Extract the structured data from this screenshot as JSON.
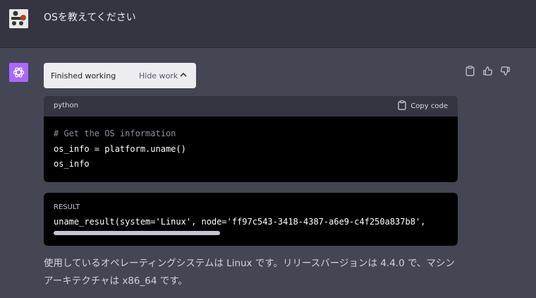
{
  "user_message": {
    "text": "OSを教えてください",
    "avatar": "user-avatar-icon"
  },
  "assistant": {
    "avatar": "openai-logo-icon",
    "status": {
      "label": "Finished working",
      "toggle_label": "Hide work",
      "toggle_icon": "chevron-up-icon"
    },
    "code": {
      "language": "python",
      "copy_label": "Copy code",
      "copy_icon": "clipboard-icon",
      "lines": [
        "# Get the OS information",
        "os_info = platform.uname()",
        "os_info"
      ]
    },
    "result": {
      "label": "RESULT",
      "text": "uname_result(system='Linux', node='ff97c543-3418-4387-a6e9-c4f250a837b8',"
    },
    "answer": "使用しているオペレーティングシステムは Linux です。リリースバージョンは 4.4.0 で、マシンアーキテクチャは x86_64 です。",
    "actions": [
      "clipboard-icon",
      "thumbs-up-icon",
      "thumbs-down-icon"
    ]
  },
  "colors": {
    "assistant_bg": "#444654",
    "user_bg": "#343541",
    "code_bg": "#000000",
    "assistant_avatar": "#ab68ff"
  }
}
